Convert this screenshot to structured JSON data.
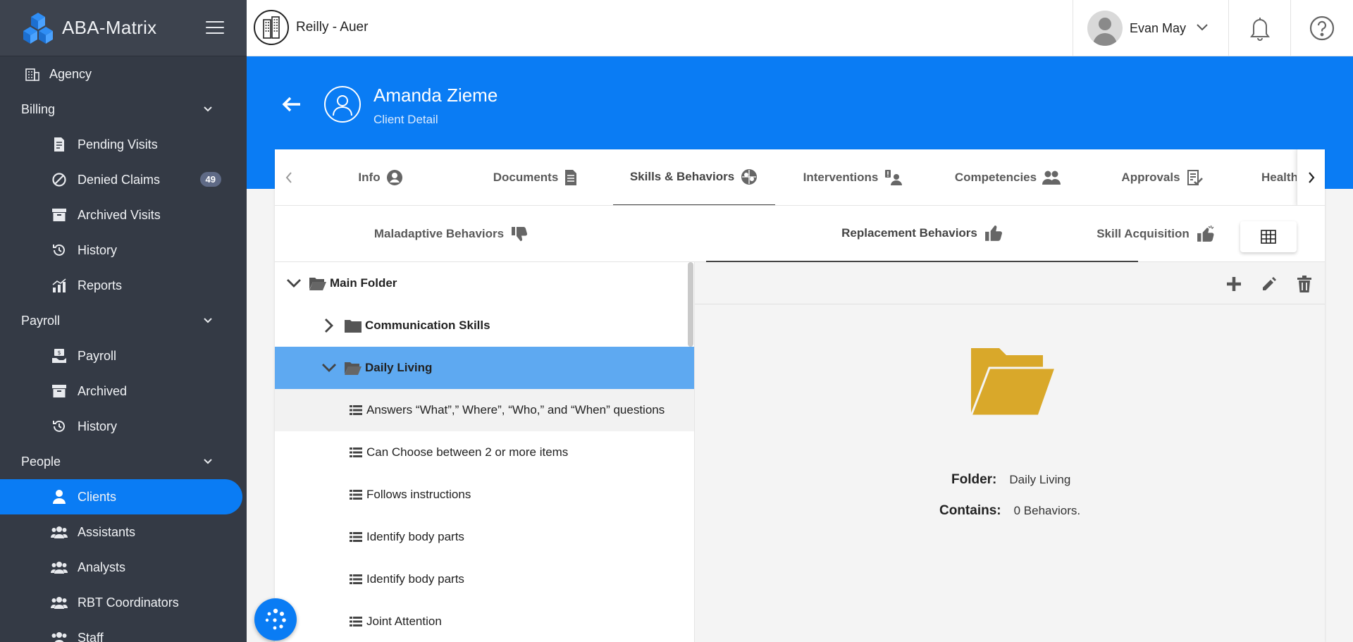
{
  "brand": {
    "name": "ABA-Matrix"
  },
  "sidebar": {
    "agency": "Agency",
    "billing": {
      "label": "Billing",
      "items": [
        "Pending Visits",
        "Denied Claims",
        "Archived Visits",
        "History",
        "Reports"
      ],
      "denied_badge": "49"
    },
    "payroll": {
      "label": "Payroll",
      "items": [
        "Payroll",
        "Archived",
        "History"
      ]
    },
    "people": {
      "label": "People",
      "items": [
        "Clients",
        "Assistants",
        "Analysts",
        "RBT Coordinators",
        "Staff"
      ]
    }
  },
  "topbar": {
    "org_name": "Reilly - Auer",
    "user_name": "Evan May"
  },
  "header": {
    "client_name": "Amanda Zieme",
    "subtitle": "Client Detail"
  },
  "tabs": [
    "Info",
    "Documents",
    "Skills & Behaviors",
    "Interventions",
    "Competencies",
    "Approvals",
    "Health"
  ],
  "subtabs": [
    "Maladaptive Behaviors",
    "Replacement Behaviors",
    "Skill Acquisition"
  ],
  "tree": {
    "main": "Main Folder",
    "communication": "Communication Skills",
    "daily": "Daily Living",
    "items": [
      "Answers “What”,” Where”, “Who,” and “When” questions",
      "Can Choose between 2 or more items",
      "Follows instructions",
      "Identify body parts",
      "Identify body parts",
      "Joint Attention"
    ]
  },
  "detail": {
    "folder_label": "Folder:",
    "folder_value": "Daily Living",
    "contains_label": "Contains:",
    "contains_value": "0 Behaviors."
  },
  "colors": {
    "primary": "#0a7cf4",
    "sidebar": "#343a45",
    "selected_row": "#5ea9f1",
    "folder": "#d9a82a"
  }
}
